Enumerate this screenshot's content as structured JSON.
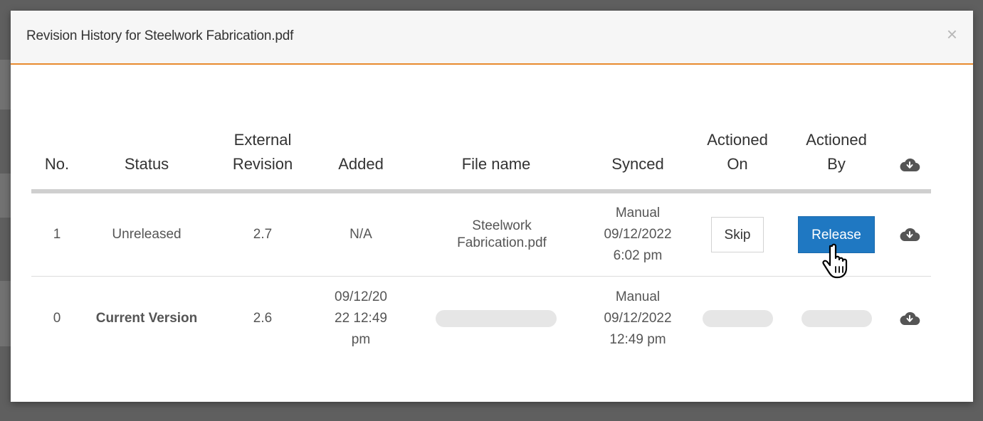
{
  "modal": {
    "title": "Revision History for Steelwork Fabrication.pdf",
    "close_label": "×"
  },
  "table": {
    "headers": {
      "no": "No.",
      "status": "Status",
      "external_revision_line1": "External",
      "external_revision_line2": "Revision",
      "added": "Added",
      "file_name": "File name",
      "synced": "Synced",
      "actioned_on_line1": "Actioned",
      "actioned_on_line2": "On",
      "actioned_by_line1": "Actioned",
      "actioned_by_line2": "By",
      "download_icon": "cloud-download-icon"
    },
    "rows": [
      {
        "no": "1",
        "status": "Unreleased",
        "external_revision": "2.7",
        "added": "N/A",
        "file_name_line1": "Steelwork",
        "file_name_line2": "Fabrication.pdf",
        "synced_line1": "Manual",
        "synced_line2": "09/12/2022",
        "synced_line3": "6:02 pm",
        "skip_label": "Skip",
        "release_label": "Release"
      },
      {
        "no": "0",
        "status": "Current Version",
        "external_revision": "2.6",
        "added_line1": "09/12/20",
        "added_line2": "22 12:49",
        "added_line3": "pm",
        "synced_line1": "Manual",
        "synced_line2": "09/12/2022",
        "synced_line3": "12:49 pm"
      }
    ]
  },
  "colors": {
    "accent_border": "#e88a2f",
    "release_button": "#1f78c2",
    "header_bg": "#f6f6f6",
    "backdrop": "#5f5f5f"
  }
}
